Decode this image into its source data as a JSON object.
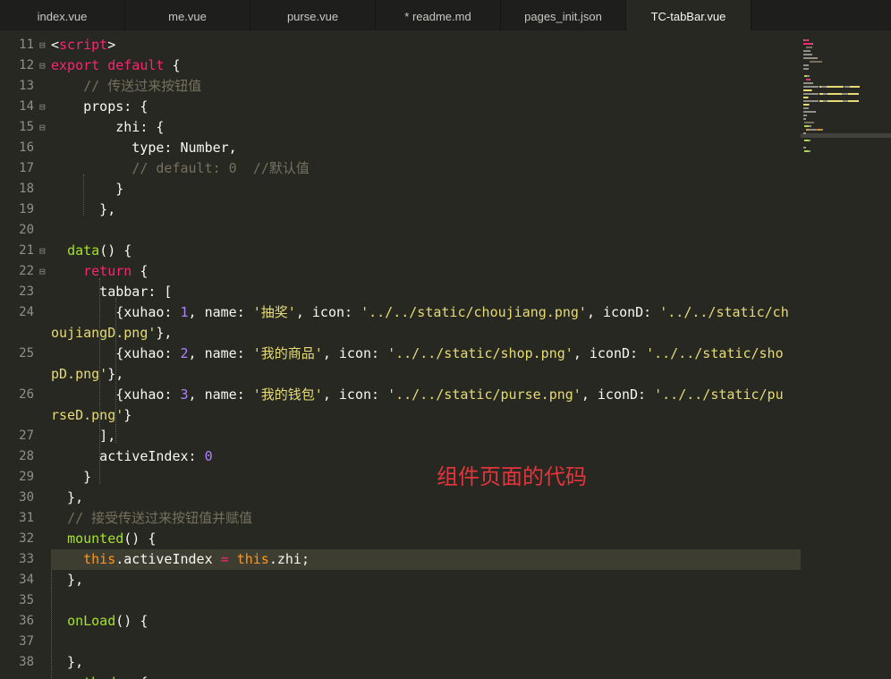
{
  "editor": {
    "tabs": [
      {
        "label": "index.vue"
      },
      {
        "label": "me.vue"
      },
      {
        "label": "purse.vue"
      },
      {
        "label": "* readme.md"
      },
      {
        "label": "pages_init.json"
      },
      {
        "label": "TC-tabBar.vue"
      }
    ],
    "lines": [
      {
        "num": "11",
        "fold": true,
        "tokens": [
          {
            "t": "<"
          },
          {
            "t": "script",
            "c": "kw"
          },
          {
            "t": ">"
          }
        ]
      },
      {
        "num": "12",
        "fold": true,
        "tokens": [
          {
            "t": "export default",
            "c": "kw"
          },
          {
            "t": " {"
          }
        ]
      },
      {
        "num": "13",
        "tokens": [
          {
            "t": "    "
          },
          {
            "t": "// 传送过来按钮值",
            "c": "cm"
          }
        ]
      },
      {
        "num": "14",
        "fold": true,
        "tokens": [
          {
            "t": "    props: {"
          }
        ]
      },
      {
        "num": "15",
        "fold": true,
        "tokens": [
          {
            "t": "        zhi: {"
          }
        ]
      },
      {
        "num": "16",
        "tokens": [
          {
            "t": "          type: Number,"
          }
        ]
      },
      {
        "num": "17",
        "tokens": [
          {
            "t": "          "
          },
          {
            "t": "// default: 0  //默认值",
            "c": "cm"
          }
        ]
      },
      {
        "num": "18",
        "tokens": [
          {
            "t": "        }"
          }
        ]
      },
      {
        "num": "19",
        "tokens": [
          {
            "t": "      },"
          }
        ]
      },
      {
        "num": "20",
        "tokens": []
      },
      {
        "num": "21",
        "fold": true,
        "tokens": [
          {
            "t": "  "
          },
          {
            "t": "data",
            "c": "fn"
          },
          {
            "t": "() {"
          }
        ]
      },
      {
        "num": "22",
        "fold": true,
        "tokens": [
          {
            "t": "    "
          },
          {
            "t": "return",
            "c": "kw"
          },
          {
            "t": " {"
          }
        ]
      },
      {
        "num": "23",
        "tokens": [
          {
            "t": "      tabbar: ["
          }
        ]
      },
      {
        "num": "24",
        "tokens": [
          {
            "t": "        {xuhao: "
          },
          {
            "t": "1",
            "c": "num"
          },
          {
            "t": ", name: "
          },
          {
            "t": "'抽奖'",
            "c": "str"
          },
          {
            "t": ", icon: "
          },
          {
            "t": "'../../static/choujiang.png'",
            "c": "str"
          },
          {
            "t": ", iconD: "
          },
          {
            "t": "'../../static/ch",
            "c": "str"
          }
        ]
      },
      {
        "num": "",
        "tokens": [
          {
            "t": "oujiangD.png'",
            "c": "str"
          },
          {
            "t": "},"
          }
        ]
      },
      {
        "num": "25",
        "tokens": [
          {
            "t": "        {xuhao: "
          },
          {
            "t": "2",
            "c": "num"
          },
          {
            "t": ", name: "
          },
          {
            "t": "'我的商品'",
            "c": "str"
          },
          {
            "t": ", icon: "
          },
          {
            "t": "'../../static/shop.png'",
            "c": "str"
          },
          {
            "t": ", iconD: "
          },
          {
            "t": "'../../static/sho",
            "c": "str"
          }
        ]
      },
      {
        "num": "",
        "tokens": [
          {
            "t": "pD.png'",
            "c": "str"
          },
          {
            "t": "},"
          }
        ]
      },
      {
        "num": "26",
        "tokens": [
          {
            "t": "        {xuhao: "
          },
          {
            "t": "3",
            "c": "num"
          },
          {
            "t": ", name: "
          },
          {
            "t": "'我的钱包'",
            "c": "str"
          },
          {
            "t": ", icon: "
          },
          {
            "t": "'../../static/purse.png'",
            "c": "str"
          },
          {
            "t": ", iconD: "
          },
          {
            "t": "'../../static/pu",
            "c": "str"
          }
        ]
      },
      {
        "num": "",
        "tokens": [
          {
            "t": "rseD.png'",
            "c": "str"
          },
          {
            "t": "}"
          }
        ]
      },
      {
        "num": "27",
        "tokens": [
          {
            "t": "      ],"
          }
        ]
      },
      {
        "num": "28",
        "tokens": [
          {
            "t": "      activeIndex: "
          },
          {
            "t": "0",
            "c": "num"
          }
        ]
      },
      {
        "num": "29",
        "tokens": [
          {
            "t": "    }"
          }
        ]
      },
      {
        "num": "30",
        "tokens": [
          {
            "t": "  },"
          }
        ]
      },
      {
        "num": "31",
        "tokens": [
          {
            "t": "  "
          },
          {
            "t": "// 接受传送过来按钮值并赋值",
            "c": "cm"
          }
        ]
      },
      {
        "num": "32",
        "tokens": [
          {
            "t": "  "
          },
          {
            "t": "mounted",
            "c": "fn"
          },
          {
            "t": "() {"
          }
        ]
      },
      {
        "num": "33",
        "current": true,
        "tokens": [
          {
            "t": "    "
          },
          {
            "t": "this",
            "c": "th"
          },
          {
            "t": ".activeIndex "
          },
          {
            "t": "=",
            "c": "kw"
          },
          {
            "t": " "
          },
          {
            "t": "this",
            "c": "th"
          },
          {
            "t": ".zhi;"
          }
        ]
      },
      {
        "num": "34",
        "tokens": [
          {
            "t": "  },"
          }
        ]
      },
      {
        "num": "35",
        "tokens": []
      },
      {
        "num": "36",
        "tokens": [
          {
            "t": "  "
          },
          {
            "t": "onLoad",
            "c": "fn"
          },
          {
            "t": "() {"
          }
        ]
      },
      {
        "num": "37",
        "tokens": []
      },
      {
        "num": "38",
        "tokens": [
          {
            "t": "  },"
          }
        ]
      },
      {
        "num": "",
        "tokens": [
          {
            "t": "  "
          },
          {
            "t": "methods",
            "c": "fn"
          },
          {
            "t": ": {"
          }
        ]
      }
    ]
  },
  "annotation": {
    "text": "组件页面的代码"
  }
}
